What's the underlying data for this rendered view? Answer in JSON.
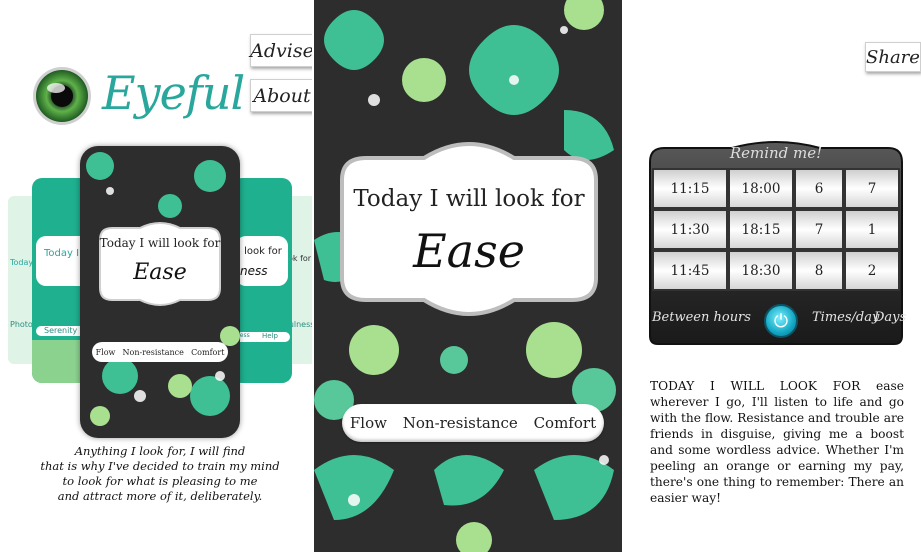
{
  "left": {
    "advise_label": "Advise",
    "about_label": "About",
    "logo_text": "Eyeful",
    "card_front": {
      "today": "Today I will look for",
      "word": "Ease",
      "pills": [
        "Flow",
        "Non-resistance",
        "Comfort"
      ]
    },
    "card_mid_left": {
      "today": "Today I",
      "footer": "Serenity"
    },
    "card_mid_right": {
      "today": "I look for",
      "word": "ness",
      "footer_a": "ness",
      "footer_b": "Help"
    },
    "card_back_left": {
      "top": "Today",
      "bottom": "Photo"
    },
    "card_back_right": {
      "top": "ok for",
      "bottom": "fulness"
    },
    "tagline": [
      "Anything I look for, I will find",
      "that is why I've decided to train my mind",
      "to look for what is pleasing to me",
      "and attract more of it, deliberately."
    ]
  },
  "center": {
    "today": "Today I will look for",
    "word": "Ease",
    "pills": [
      "Flow",
      "Non-resistance",
      "Comfort"
    ]
  },
  "right": {
    "share_label": "Share",
    "remind_title": "Remind me!",
    "rows": [
      [
        "11:15",
        "18:00",
        "6",
        "7"
      ],
      [
        "11:30",
        "18:15",
        "7",
        "1"
      ],
      [
        "11:45",
        "18:30",
        "8",
        "2"
      ]
    ],
    "between_hours": "Between hours",
    "times_day": "Times/day",
    "days": "Days",
    "description": "TODAY I WILL LOOK FOR ease wherever I go, I'll listen to life and go with the flow. Resistance and trouble are friends in disguise, giving me a boost and some wordless advice. Whether I'm peeling an orange or earning my pay, there's one thing to remember: There an easier way!"
  },
  "colors": {
    "teal": "#2aa79c",
    "dark": "#2d2d2d",
    "leaf_green": "#58c79a",
    "leaf_light": "#a8e08f"
  }
}
